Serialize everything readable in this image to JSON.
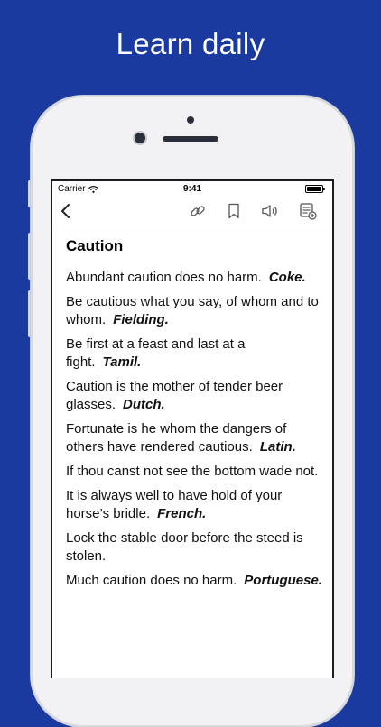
{
  "promo": {
    "headline": "Learn daily"
  },
  "status_bar": {
    "carrier": "Carrier",
    "time": "9:41"
  },
  "toolbar": {
    "icons": [
      "back-icon",
      "link-icon",
      "bookmark-icon",
      "speaker-icon",
      "add-to-list-icon"
    ]
  },
  "topic": {
    "title": "Caution",
    "proverbs": [
      {
        "text": "Abundant caution does no harm.",
        "author": "Coke."
      },
      {
        "text": "Be cautious what you say, of whom and to whom.",
        "author": "Fielding."
      },
      {
        "text": "Be first at a feast and last at a fight.",
        "author": "Tamil."
      },
      {
        "text": "Caution is the mother of tender beer glasses.",
        "author": "Dutch."
      },
      {
        "text": "Fortunate is he whom the dangers of others have rendered cautious.",
        "author": "Latin."
      },
      {
        "text": "If thou canst not see the bottom wade not.",
        "author": ""
      },
      {
        "text": "It is always well to have hold of your horse’s bridle.",
        "author": "French."
      },
      {
        "text": "Lock the stable door before the steed is stolen.",
        "author": ""
      },
      {
        "text": "Much caution does no harm.",
        "author": "Portuguese."
      }
    ]
  },
  "colors": {
    "background": "#1a3aa0",
    "screen": "#ffffff",
    "text": "#111111"
  }
}
